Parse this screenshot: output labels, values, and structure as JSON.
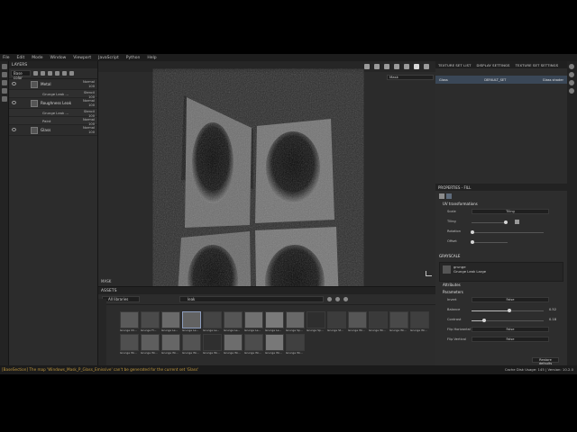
{
  "menu": [
    "File",
    "Edit",
    "Mode",
    "Window",
    "Viewport",
    "JavaScript",
    "Python",
    "Help"
  ],
  "layers_panel": {
    "title": "LAYERS",
    "blend": "Base color",
    "layers": [
      {
        "name": "Metal",
        "right_top": "Normal",
        "right_bottom": "100"
      },
      {
        "name": "Grunge Leak …",
        "right_top": "Stencil",
        "right_bottom": "100",
        "sub": true
      },
      {
        "name": "Roughness Leak",
        "right_top": "Normal",
        "right_bottom": "100"
      },
      {
        "name": "Grunge Leak …",
        "right_top": "Stencil",
        "right_bottom": "100",
        "sub": true
      },
      {
        "name": "Paint",
        "right_top": "Normal",
        "right_bottom": "100",
        "sub": true
      },
      {
        "name": "Glass",
        "right_top": "Normal",
        "right_bottom": "100"
      }
    ]
  },
  "viewport": {
    "mode": "Mask",
    "bottom_label": "MASK"
  },
  "assets": {
    "title": "ASSETS",
    "library": "All libraries",
    "search": "leak",
    "items": [
      {
        "label": "Grunge Ch...",
        "tone": "#5a5a5a"
      },
      {
        "label": "Grunge Fl...",
        "tone": "#4a4a4a"
      },
      {
        "label": "Grunge Le...",
        "tone": "#6a6a6a"
      },
      {
        "label": "Grunge Le...",
        "tone": "#626262"
      },
      {
        "label": "Grunge Le...",
        "tone": "#444"
      },
      {
        "label": "Grunge Le...",
        "tone": "#555"
      },
      {
        "label": "Grunge Le...",
        "tone": "#707070"
      },
      {
        "label": "Grunge Le...",
        "tone": "#7a7a7a"
      },
      {
        "label": "Grunge Sp...",
        "tone": "#686868"
      },
      {
        "label": "Grunge Sp...",
        "tone": "#2e2e2e"
      },
      {
        "label": "Grunge St...",
        "tone": "#3c3c3c"
      },
      {
        "label": "Grunge Wi...",
        "tone": "#565656"
      },
      {
        "label": "Grunge Wi...",
        "tone": "#3a3a3a"
      },
      {
        "label": "Grunge Wi...",
        "tone": "#494949"
      },
      {
        "label": "Grunge Wi...",
        "tone": "#3f3f3f"
      },
      {
        "label": "Grunge Wi...",
        "tone": "#4f4f4f"
      },
      {
        "label": "Grunge Wi...",
        "tone": "#5e5e5e"
      },
      {
        "label": "Grunge Wi...",
        "tone": "#666"
      },
      {
        "label": "Grunge Wi...",
        "tone": "#535353"
      },
      {
        "label": "Grunge Wi...",
        "tone": "#2f2f2f"
      },
      {
        "label": "Grunge Wi...",
        "tone": "#6d6d6d"
      },
      {
        "label": "Grunge Wi...",
        "tone": "#4c4c4c"
      },
      {
        "label": "Grunge Wi...",
        "tone": "#787878"
      },
      {
        "label": "Grunge Wi...",
        "tone": "#404040"
      }
    ]
  },
  "texture_set": {
    "tabs": [
      "TEXTURE SET LIST",
      "DISPLAY SETTINGS",
      "TEXTURE SET SETTINGS"
    ],
    "row_name": "Glass",
    "row_mid": "DEFAULT_SET",
    "row_right": "Glass shader"
  },
  "properties": {
    "title": "PROPERTIES - FILL",
    "uv_section": "UV transformations",
    "uv_label": "Scale",
    "uv_value": "Tiling",
    "tiling_label": "Tiling",
    "rotation_label": "Rotation",
    "offset_label": "Offset",
    "grayscale_title": "GRAYSCALE",
    "grayscale_name": "grunge",
    "grayscale_sub": "Grunge Leak Large",
    "attributes": "Attributes",
    "parameters": "Parameters",
    "params": [
      {
        "label": "Invert",
        "value": "False",
        "type": "box"
      },
      {
        "label": "Balance",
        "value": "0.52",
        "type": "slider",
        "level": 0.52
      },
      {
        "label": "Contrast",
        "value": "0.18",
        "type": "slider",
        "level": 0.18
      },
      {
        "label": "Flip Horizontal",
        "value": "False",
        "type": "box"
      },
      {
        "label": "Flip Vertical",
        "value": "False",
        "type": "box"
      }
    ],
    "reset": "Restore defaults"
  },
  "status": {
    "message": "[BaseSection] The map 'Windows_Mask_P_Glass_Emissive' can't be generated for the current set 'Glass'",
    "right": "Cache Disk Usage: 145 | Version: 10.2.0"
  },
  "colors": {
    "selection": "#3a4757",
    "status_warning": "#c49a3d"
  }
}
